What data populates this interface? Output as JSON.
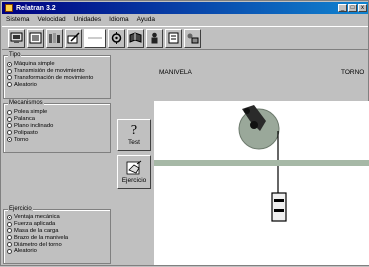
{
  "window": {
    "title": "Relatran 3.2",
    "controls": [
      "_",
      "□",
      "x"
    ]
  },
  "menu": [
    "Sistema",
    "Velocidad",
    "Unidades",
    "Idioma",
    "Ayuda"
  ],
  "toolbar": {
    "tools": [
      "screen-icon",
      "list-icon",
      "books-icon",
      "pencil-icon",
      "blank-icon",
      "gear-icon",
      "book-icon",
      "person-icon",
      "document-icon",
      "tools-icon"
    ]
  },
  "tipo": {
    "title": "Tipo",
    "options": [
      {
        "label": "Máquina simple",
        "selected": true
      },
      {
        "label": "Transmisión de movimiento",
        "selected": false
      },
      {
        "label": "Transformación de movimiento",
        "selected": false
      },
      {
        "label": "Aleatorio",
        "selected": false
      }
    ]
  },
  "mecanismo": {
    "title": "Mecanismos",
    "options": [
      {
        "label": "Polea simple",
        "selected": false
      },
      {
        "label": "Palanca",
        "selected": false
      },
      {
        "label": "Plano inclinado",
        "selected": false
      },
      {
        "label": "Polipasto",
        "selected": false
      },
      {
        "label": "Torno",
        "selected": true
      }
    ]
  },
  "ejercicio": {
    "title": "Ejercicio",
    "options": [
      {
        "label": "Ventaja mecánica",
        "selected": true
      },
      {
        "label": "Fuerza aplicada",
        "selected": false
      },
      {
        "label": "Masa de la carga",
        "selected": false
      },
      {
        "label": "Brazo de la manivela",
        "selected": false
      },
      {
        "label": "Diámetro del torno",
        "selected": false
      },
      {
        "label": "Aleatorio",
        "selected": false
      }
    ]
  },
  "buttons": {
    "test": {
      "icon": "?",
      "label": "Test"
    },
    "ejercicio": {
      "label": "Ejercicio"
    }
  },
  "columns": {
    "left": "MANIVELA",
    "right": "TORNO"
  },
  "colors": {
    "title_start": "#000080",
    "title_end": "#1084d0",
    "drum": "#9aa89a",
    "load": "#f0f0f0"
  }
}
